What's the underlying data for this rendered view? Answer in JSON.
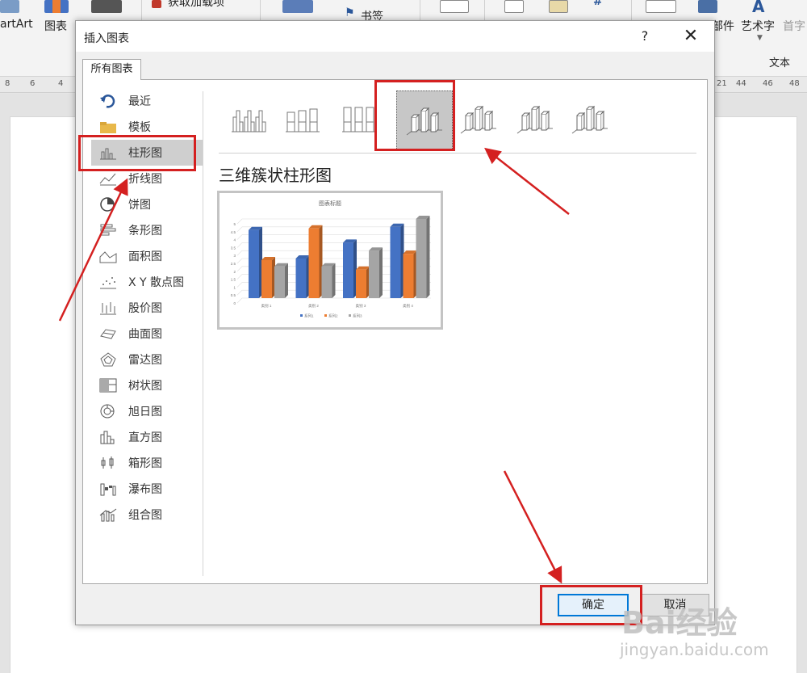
{
  "ribbon": {
    "smartart_label": "artArt",
    "chart_label": "图表",
    "addins_label": "获取加载项",
    "bookmark_label": "书签",
    "parts_label": "部件",
    "wordart_label": "艺术字",
    "dropcap_label": "首字",
    "group_text": "文本"
  },
  "ruler": {
    "left": [
      "8",
      "6",
      "4"
    ],
    "right": [
      "21",
      "44",
      "46",
      "48"
    ]
  },
  "dialog": {
    "title": "插入图表",
    "help": "?",
    "close": "✕",
    "tab": "所有图表",
    "ok": "确定",
    "cancel": "取消"
  },
  "sidebar": {
    "items": [
      {
        "label": "最近",
        "icon": "undo-icon"
      },
      {
        "label": "模板",
        "icon": "folder-icon"
      },
      {
        "label": "柱形图",
        "icon": "column-chart-icon",
        "selected": true
      },
      {
        "label": "折线图",
        "icon": "line-chart-icon"
      },
      {
        "label": "饼图",
        "icon": "pie-chart-icon"
      },
      {
        "label": "条形图",
        "icon": "bar-chart-icon"
      },
      {
        "label": "面积图",
        "icon": "area-chart-icon"
      },
      {
        "label": "X Y 散点图",
        "icon": "scatter-chart-icon"
      },
      {
        "label": "股价图",
        "icon": "stock-chart-icon"
      },
      {
        "label": "曲面图",
        "icon": "surface-chart-icon"
      },
      {
        "label": "雷达图",
        "icon": "radar-chart-icon"
      },
      {
        "label": "树状图",
        "icon": "treemap-chart-icon"
      },
      {
        "label": "旭日图",
        "icon": "sunburst-chart-icon"
      },
      {
        "label": "直方图",
        "icon": "histogram-chart-icon"
      },
      {
        "label": "箱形图",
        "icon": "boxwhisker-chart-icon"
      },
      {
        "label": "瀑布图",
        "icon": "waterfall-chart-icon"
      },
      {
        "label": "组合图",
        "icon": "combo-chart-icon"
      }
    ]
  },
  "subtypes": {
    "selected_name": "三维簇状柱形图",
    "items": [
      "clustered-column",
      "stacked-column",
      "100-stacked-column",
      "3d-clustered-column",
      "3d-stacked-column",
      "3d-100-stacked-column",
      "3d-column"
    ],
    "selected_index": 3
  },
  "chart_data": {
    "type": "bar",
    "title": "图表标题",
    "categories": [
      "类别 1",
      "类别 2",
      "类别 3",
      "类别 4"
    ],
    "series": [
      {
        "name": "系列1",
        "values": [
          4.3,
          2.5,
          3.5,
          4.5
        ],
        "color": "#4472c4"
      },
      {
        "name": "系列2",
        "values": [
          2.4,
          4.4,
          1.8,
          2.8
        ],
        "color": "#ed7d31"
      },
      {
        "name": "系列3",
        "values": [
          2.0,
          2.0,
          3.0,
          5.0
        ],
        "color": "#a5a5a5"
      }
    ],
    "ylim": [
      0,
      5
    ],
    "yticks": [
      "0",
      "0.5",
      "1",
      "1.5",
      "2",
      "2.5",
      "3",
      "3.5",
      "4",
      "4.5",
      "5"
    ],
    "legend": "bottom",
    "grid": true
  },
  "watermark": {
    "brand": "Bai经验",
    "url": "jingyan.baidu.com"
  },
  "colors": {
    "annotation_red": "#d42020",
    "accent_blue": "#0078d7"
  }
}
